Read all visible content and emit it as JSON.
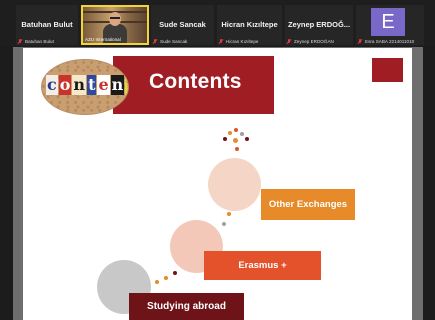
{
  "participants": {
    "tile1": {
      "display_name": "Batuhan Bulut",
      "label": "Batuhan Bulut"
    },
    "tile2": {
      "label": "AZU International"
    },
    "tile3": {
      "display_name": "Sude Sancak",
      "label": "Sude Sancak"
    },
    "tile4": {
      "display_name": "Hicran Kızıltepe",
      "label": "Hicran Kızıltepe"
    },
    "tile5": {
      "display_name": "Zeynep  ERDOĞ...",
      "label": "Zeynep ERDOĞAN"
    },
    "tile6": {
      "avatar_letter": "E",
      "label": "Esra SABA 2214011010"
    }
  },
  "slide": {
    "title": "Contents",
    "image_letters": [
      "c",
      "o",
      "n",
      "t",
      "e",
      "n",
      "t"
    ],
    "items": [
      {
        "label": "Other Exchanges"
      },
      {
        "label": "Erasmus +"
      },
      {
        "label": "Studying abroad"
      }
    ]
  },
  "colors": {
    "brand_red": "#a01d24",
    "orange": "#e68a2a",
    "red_orange": "#e3522a",
    "dark_red": "#6e1418",
    "speaking_border": "#f0d43a",
    "avatar_purple": "#7a68c8"
  }
}
